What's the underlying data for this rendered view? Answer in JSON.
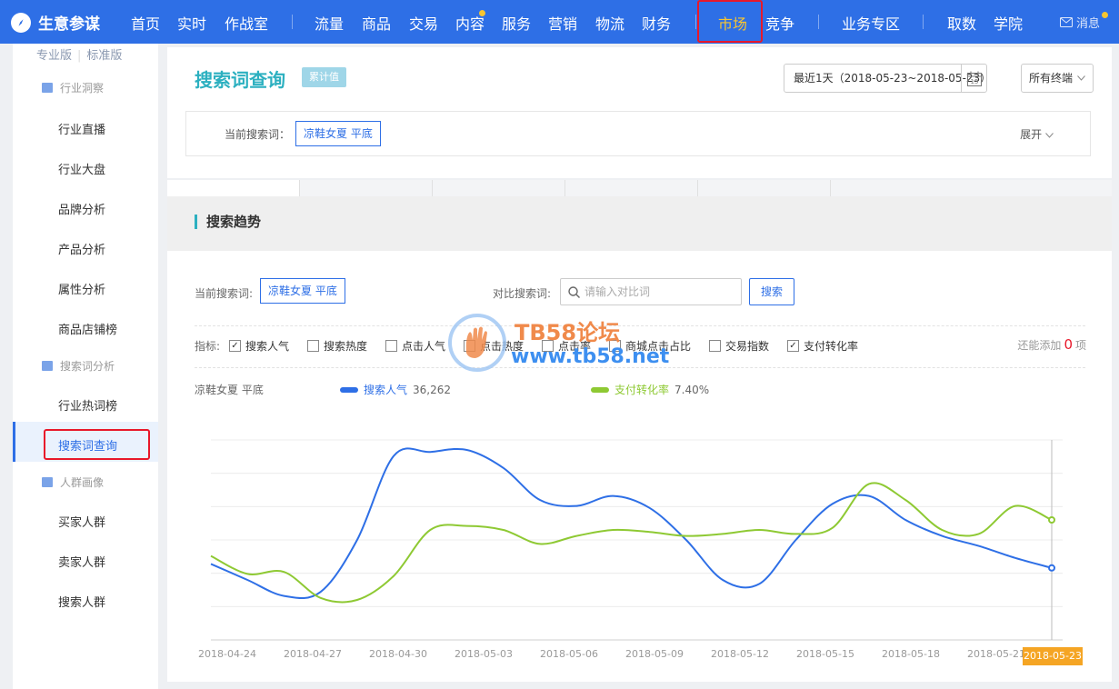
{
  "brand": {
    "name": "生意参谋"
  },
  "topnav": {
    "items": [
      "首页",
      "实时",
      "作战室",
      "流量",
      "商品",
      "交易",
      "内容",
      "服务",
      "营销",
      "物流",
      "财务",
      "市场",
      "竞争",
      "业务专区",
      "取数",
      "学院"
    ],
    "active": "市场",
    "message": "消息",
    "colors": {
      "bg": "#2e6fe6",
      "active": "#f7c531",
      "highlight": "#e8182a"
    }
  },
  "sidebar": {
    "versions": [
      "专业版",
      "标准版"
    ],
    "groups": [
      {
        "label": "行业洞察",
        "items": [
          "行业直播",
          "行业大盘",
          "品牌分析",
          "产品分析",
          "属性分析",
          "商品店铺榜"
        ]
      },
      {
        "label": "搜索词分析",
        "items": [
          "行业热词榜",
          "搜索词查询"
        ]
      },
      {
        "label": "人群画像",
        "items": [
          "买家人群",
          "卖家人群",
          "搜索人群"
        ]
      }
    ],
    "active": "搜索词查询"
  },
  "header": {
    "title": "搜索词查询",
    "badge": "累计值",
    "date_range": "最近1天（2018-05-23~2018-05-23）",
    "calendar_day": "15",
    "terminal": "所有终端",
    "current_label": "当前搜索词：",
    "current_keyword": "凉鞋女夏 平底",
    "expand": "展开"
  },
  "trend": {
    "title": "搜索趋势",
    "current_label": "当前搜索词:",
    "current_keyword": "凉鞋女夏 平底",
    "compare_label": "对比搜索词:",
    "compare_placeholder": "请输入对比词",
    "search_btn": "搜索",
    "metrics_label": "指标:",
    "metrics": [
      {
        "label": "搜索人气",
        "checked": true
      },
      {
        "label": "搜索热度",
        "checked": false
      },
      {
        "label": "点击人气",
        "checked": false
      },
      {
        "label": "点击热度",
        "checked": false
      },
      {
        "label": "点击率",
        "checked": false
      },
      {
        "label": "商城点击占比",
        "checked": false
      },
      {
        "label": "交易指数",
        "checked": false
      },
      {
        "label": "支付转化率",
        "checked": true
      }
    ],
    "remain_prefix": "还能添加",
    "remain_count": "0",
    "remain_suffix": "项",
    "legend_keyword": "凉鞋女夏  平底",
    "watermark": {
      "line1": "TB58论坛",
      "line2": "www.tb58.net"
    }
  },
  "chart_data": {
    "type": "line",
    "x_labels": [
      "2018-04-24",
      "2018-04-27",
      "2018-04-30",
      "2018-05-03",
      "2018-05-06",
      "2018-05-09",
      "2018-05-12",
      "2018-05-15",
      "2018-05-18",
      "2018-05-21",
      "2018-05-23"
    ],
    "highlight_x": "2018-05-23",
    "series": [
      {
        "name": "搜索人气",
        "latest": "36,262",
        "color": "#2e6fe6",
        "values": [
          38,
          30,
          22,
          24,
          50,
          92,
          94,
          95,
          86,
          70,
          67,
          72,
          66,
          50,
          30,
          28,
          50,
          68,
          72,
          60,
          52,
          47,
          41,
          36
        ]
      },
      {
        "name": "支付转化率",
        "latest": "7.40%",
        "color": "#8ec933",
        "values": [
          42,
          33,
          34,
          21,
          20,
          32,
          55,
          57,
          55,
          48,
          52,
          55,
          54,
          52,
          53,
          55,
          53,
          56,
          78,
          70,
          55,
          53,
          67,
          60
        ]
      }
    ],
    "grid": true
  }
}
